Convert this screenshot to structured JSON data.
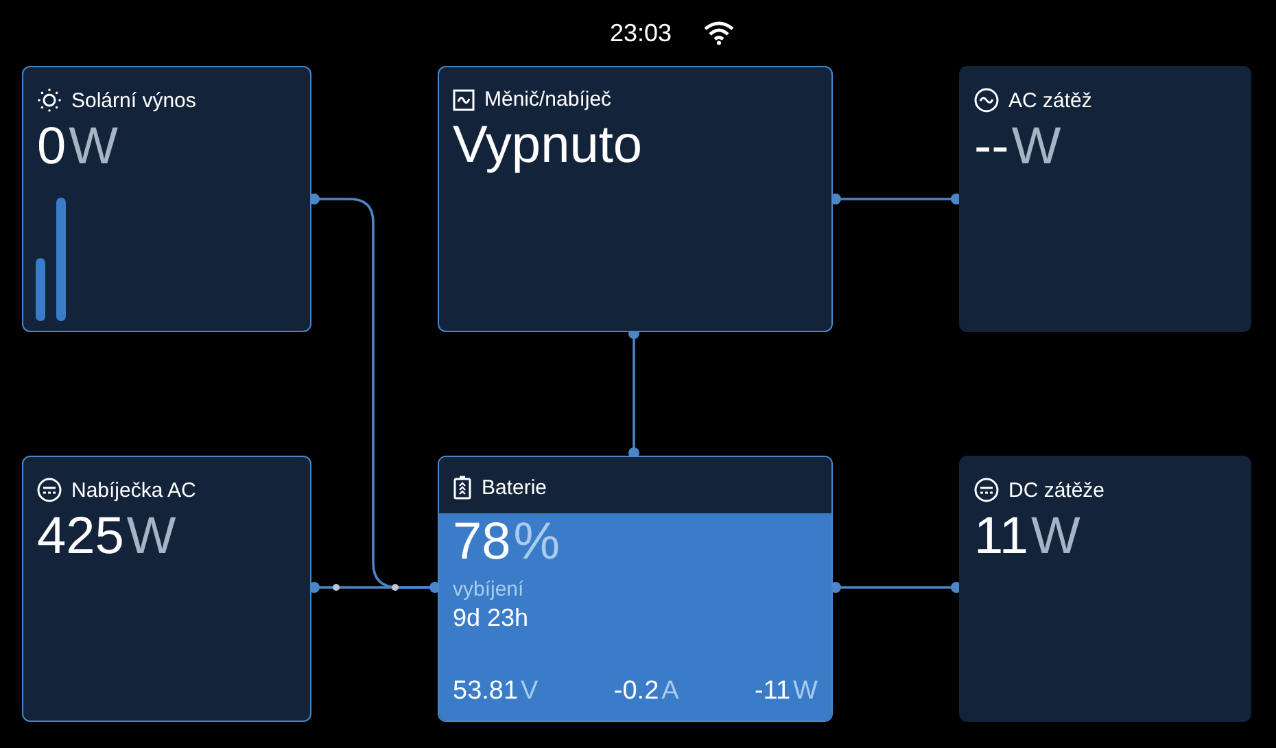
{
  "status_bar": {
    "time": "23:03"
  },
  "cards": [
    {
      "kind": "solar",
      "title": "Solární výnos",
      "value": "0",
      "unit": "W",
      "outlined": true
    },
    {
      "kind": "inverter",
      "title": "Měnič/nabíječ",
      "value": "Vypnuto",
      "outlined": true
    },
    {
      "kind": "ac_load",
      "title": "AC zátěž",
      "value": "--",
      "unit": "W",
      "outlined": false
    },
    {
      "kind": "charger",
      "title": "Nabíječka AC",
      "value": "425",
      "unit": "W",
      "outlined": true
    },
    {
      "kind": "battery",
      "title": "Baterie",
      "value": "78",
      "unit": "%",
      "state": "vybíjení",
      "time_to_go": "9d 23h",
      "outlined": true,
      "readings": [
        {
          "value": "53.81",
          "unit": "V"
        },
        {
          "value": "-0.2",
          "unit": "A"
        },
        {
          "value": "-11",
          "unit": "W"
        }
      ]
    },
    {
      "kind": "dc_load",
      "title": "DC zátěže",
      "value": "11",
      "unit": "W",
      "outlined": false
    }
  ]
}
